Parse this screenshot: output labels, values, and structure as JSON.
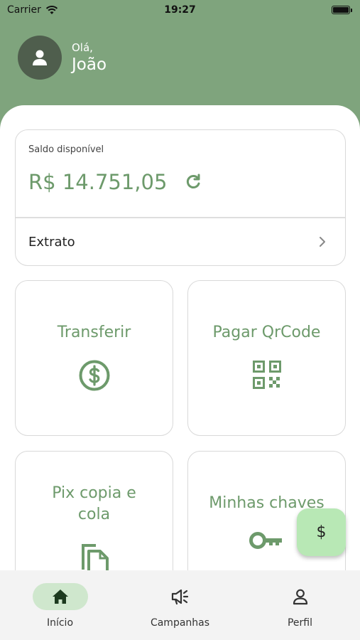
{
  "status": {
    "carrier": "Carrier",
    "time": "19:27"
  },
  "header": {
    "greeting": "Olá,",
    "name": "João"
  },
  "balance": {
    "label": "Saldo disponível",
    "amount": "R$ 14.751,05",
    "statement_label": "Extrato"
  },
  "tiles": [
    {
      "label": "Transferir",
      "icon": "dollar-circle-icon"
    },
    {
      "label": "Pagar QrCode",
      "icon": "qr-code-icon"
    },
    {
      "label": "Pix copia e cola",
      "icon": "copy-icon"
    },
    {
      "label": "Minhas chaves",
      "icon": "key-icon"
    }
  ],
  "fab": {
    "label": "$"
  },
  "nav": [
    {
      "label": "Início",
      "icon": "home-icon",
      "active": true
    },
    {
      "label": "Campanhas",
      "icon": "megaphone-icon",
      "active": false
    },
    {
      "label": "Perfil",
      "icon": "person-icon",
      "active": false
    }
  ],
  "colors": {
    "brand": "#7fa47d",
    "accent_text": "#6d9a6b",
    "fab": "#b8e8b5",
    "nav_active": "#cfe7cd"
  }
}
